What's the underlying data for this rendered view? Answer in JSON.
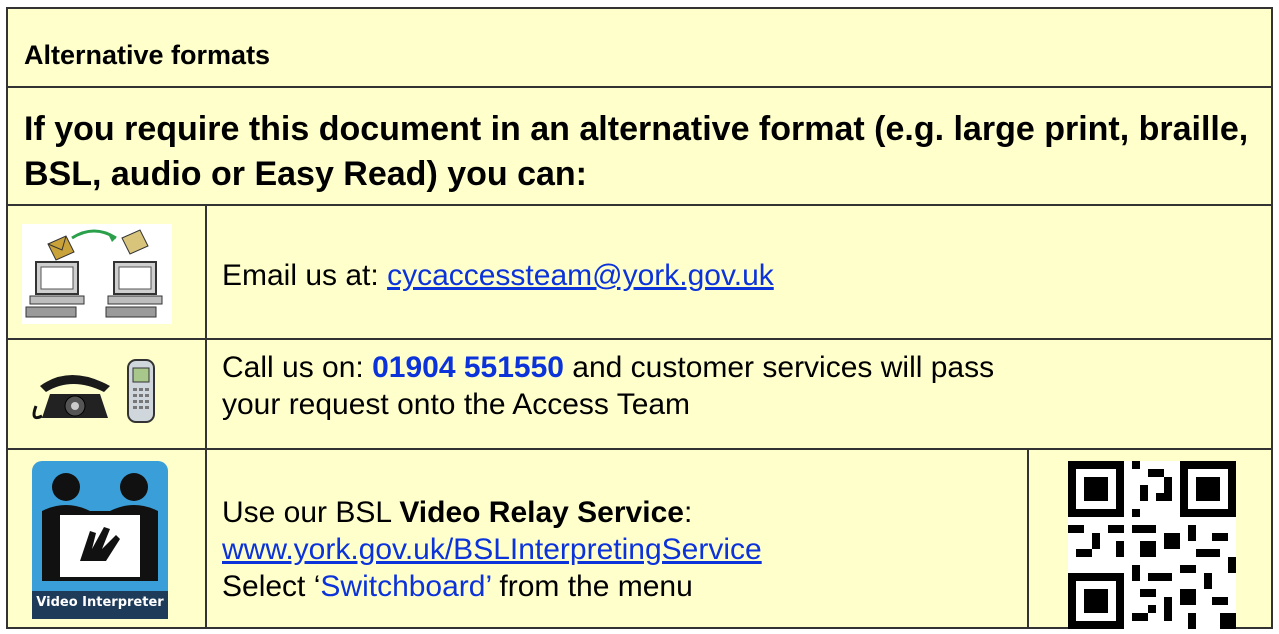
{
  "heading": "Alternative formats",
  "intro": "If you require this document in an alternative format (e.g. large print, braille, BSL, audio or Easy Read) you can:",
  "email": {
    "label": "Email us at: ",
    "address": "cycaccessteam@york.gov.uk",
    "icon": "email-computers-icon"
  },
  "phone": {
    "prefix": "Call us on: ",
    "number": "01904 551550",
    "suffix": " and customer services will pass",
    "line2": "your request onto the Access Team",
    "icon": "telephone-icon"
  },
  "video": {
    "prefix": "Use our BSL ",
    "service": "Video Relay Service",
    "colon": ":",
    "url": "www.york.gov.uk/BSLInterpretingService",
    "select_prefix": "Select ‘",
    "select_item": "Switchboard’",
    "select_suffix": " from the menu",
    "icon_label": "Video Interpreter",
    "qr_icon": "qr-code-icon"
  },
  "colors": {
    "background": "#ffffcc",
    "link": "#0b33d9",
    "border": "#333333",
    "icon_blue": "#3a9fd8"
  }
}
